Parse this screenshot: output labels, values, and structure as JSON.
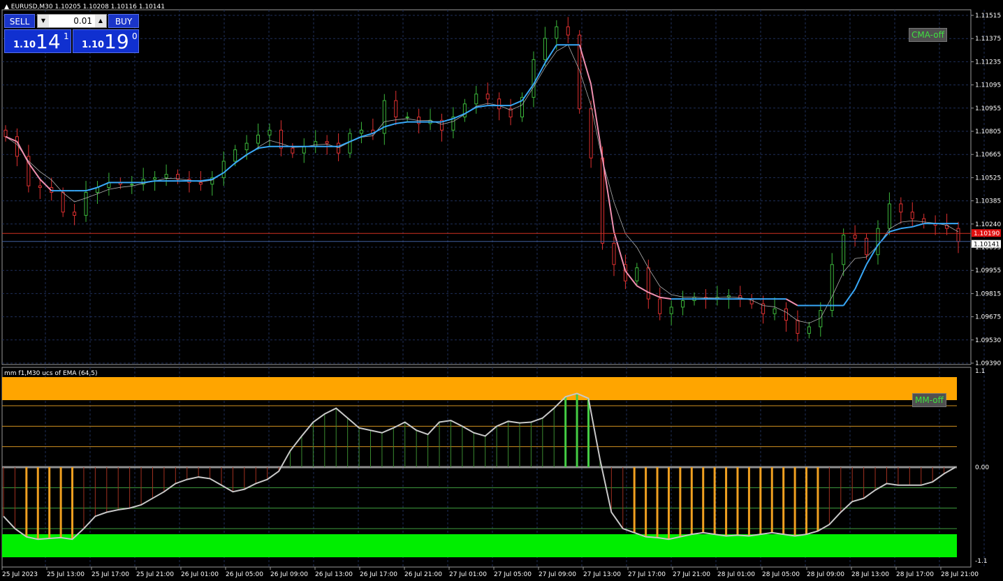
{
  "chart_header": {
    "symbol_line": "EURUSD,M30  1.10205 1.10208 1.10116 1.10141",
    "indicator_line": "mm f1,M30 ucs of EMA (64,5)"
  },
  "trade_panel": {
    "sell_label": "SELL",
    "buy_label": "BUY",
    "lot_value": "0.01",
    "sell_price_prefix": "1.10",
    "sell_price_big": "14",
    "sell_price_sup": "1",
    "buy_price_prefix": "1.10",
    "buy_price_big": "19",
    "buy_price_sup": "0"
  },
  "buttons": {
    "cma_off": "CMA-off",
    "mm_off": "MM-off"
  },
  "price_axis": {
    "labels": [
      "1.11515",
      "1.11375",
      "1.11235",
      "1.11095",
      "1.10955",
      "1.10805",
      "1.10665",
      "1.10525",
      "1.10385",
      "1.10240",
      "1.10095",
      "1.09955",
      "1.09815",
      "1.09675",
      "1.09530",
      "1.09390"
    ],
    "ask_tag": "1.10190",
    "bid_tag": "1.10141"
  },
  "indicator_axis": {
    "labels": [
      "1.1",
      "0.00",
      "-1.1"
    ]
  },
  "time_axis": {
    "labels": [
      "25 Jul 2023",
      "25 Jul 13:00",
      "25 Jul 17:00",
      "25 Jul 21:00",
      "26 Jul 01:00",
      "26 Jul 05:00",
      "26 Jul 09:00",
      "26 Jul 13:00",
      "26 Jul 17:00",
      "26 Jul 21:00",
      "27 Jul 01:00",
      "27 Jul 05:00",
      "27 Jul 09:00",
      "27 Jul 13:00",
      "27 Jul 17:00",
      "27 Jul 21:00",
      "28 Jul 01:00",
      "28 Jul 05:00",
      "28 Jul 09:00",
      "28 Jul 13:00",
      "28 Jul 17:00",
      "28 Jul 21:00"
    ]
  },
  "colors": {
    "background": "#000000",
    "grid": "#1f2f5a",
    "bull_candle": "#3cb83c",
    "bear_candle": "#e03030",
    "ma_up": "#38a8f8",
    "ma_down": "#f090b0",
    "ask_line": "#d03020",
    "bid_line": "#4060a0",
    "overbought_band": "#ffa500",
    "oversold_band": "#00ee00",
    "hist_pos": "#3a8a30",
    "hist_pos_strong": "#44cc44",
    "hist_neg": "#a03020",
    "hist_neg_strong": "#f0a020",
    "osc_line": "#c8c8c8"
  },
  "chart_data": [
    {
      "type": "candlestick",
      "title": "EURUSD,M30",
      "series": [
        {
          "name": "close",
          "values": [
            1.1078,
            1.1066,
            1.1048,
            1.1047,
            1.1044,
            1.1032,
            1.103,
            1.1044,
            1.1047,
            1.105,
            1.1049,
            1.1049,
            1.1052,
            1.1053,
            1.1055,
            1.1052,
            1.105,
            1.1049,
            1.1053,
            1.1063,
            1.107,
            1.1074,
            1.1079,
            1.1082,
            1.1071,
            1.1068,
            1.1072,
            1.1075,
            1.1074,
            1.1068,
            1.108,
            1.1082,
            1.108,
            1.11,
            1.109,
            1.109,
            1.1086,
            1.1088,
            1.1082,
            1.109,
            1.1098,
            1.1104,
            1.1101,
            1.1095,
            1.109,
            1.1102,
            1.1125,
            1.1138,
            1.1145,
            1.114,
            1.1095,
            1.1065,
            1.1013,
            1.1,
            1.099,
            1.0998,
            1.0979,
            1.097,
            1.0974,
            1.0978,
            1.098,
            1.0979,
            1.098,
            1.0981,
            1.0979,
            1.0976,
            1.097,
            1.0973,
            1.0966,
            1.0958,
            1.0962,
            1.0972,
            1.1,
            1.1018,
            1.1016,
            1.1006,
            1.1022,
            1.1037,
            1.1032,
            1.1028,
            1.1025,
            1.1024,
            1.1022,
            1.1014
          ]
        }
      ],
      "moving_average_step": [
        1.1078,
        1.1075,
        1.1062,
        1.1052,
        1.1045,
        1.1045,
        1.1045,
        1.1045,
        1.1047,
        1.105,
        1.105,
        1.105,
        1.105,
        1.1051,
        1.1051,
        1.1051,
        1.1051,
        1.1051,
        1.1052,
        1.1056,
        1.1062,
        1.1067,
        1.1071,
        1.1072,
        1.1072,
        1.1072,
        1.1072,
        1.1072,
        1.1072,
        1.1072,
        1.1075,
        1.1078,
        1.108,
        1.1084,
        1.1086,
        1.1087,
        1.1087,
        1.1087,
        1.1087,
        1.1089,
        1.1092,
        1.1096,
        1.1097,
        1.1097,
        1.1097,
        1.11,
        1.111,
        1.1123,
        1.1134,
        1.1134,
        1.1134,
        1.111,
        1.1065,
        1.102,
        1.0996,
        1.0987,
        1.0983,
        1.098,
        1.0979,
        1.0979,
        1.0979,
        1.0979,
        1.0979,
        1.0979,
        1.0979,
        1.0979,
        1.0979,
        1.0979,
        1.0979,
        1.0975,
        1.0975,
        1.0975,
        1.0975,
        1.0975,
        1.0985,
        1.1,
        1.1012,
        1.102,
        1.1022,
        1.1023,
        1.1025,
        1.1025,
        1.1025,
        1.1025
      ],
      "ylim": [
        1.0939,
        1.1152
      ],
      "ask": 1.1019,
      "bid": 1.10141
    },
    {
      "type": "histogram",
      "title": "mm f1,M30 ucs of EMA (64,5)",
      "ylim": [
        -1.1,
        1.1
      ],
      "levels": [
        0.75,
        0.5,
        0.25,
        0,
        -0.25,
        -0.5,
        -0.75
      ],
      "values": [
        -0.6,
        -0.75,
        -0.85,
        -0.88,
        -0.87,
        -0.86,
        -0.88,
        -0.75,
        -0.6,
        -0.55,
        -0.52,
        -0.5,
        -0.46,
        -0.38,
        -0.3,
        -0.2,
        -0.15,
        -0.12,
        -0.14,
        -0.22,
        -0.3,
        -0.27,
        -0.2,
        -0.15,
        -0.05,
        0.2,
        0.38,
        0.55,
        0.65,
        0.72,
        0.6,
        0.48,
        0.45,
        0.42,
        0.48,
        0.55,
        0.45,
        0.4,
        0.55,
        0.57,
        0.5,
        0.42,
        0.38,
        0.5,
        0.56,
        0.54,
        0.55,
        0.6,
        0.72,
        0.86,
        0.9,
        0.84,
        0.1,
        -0.55,
        -0.75,
        -0.8,
        -0.85,
        -0.86,
        -0.88,
        -0.85,
        -0.82,
        -0.8,
        -0.82,
        -0.84,
        -0.83,
        -0.84,
        -0.82,
        -0.8,
        -0.82,
        -0.84,
        -0.82,
        -0.78,
        -0.7,
        -0.55,
        -0.42,
        -0.38,
        -0.28,
        -0.2,
        -0.22,
        -0.22,
        -0.22,
        -0.18,
        -0.08,
        0.0
      ]
    }
  ]
}
